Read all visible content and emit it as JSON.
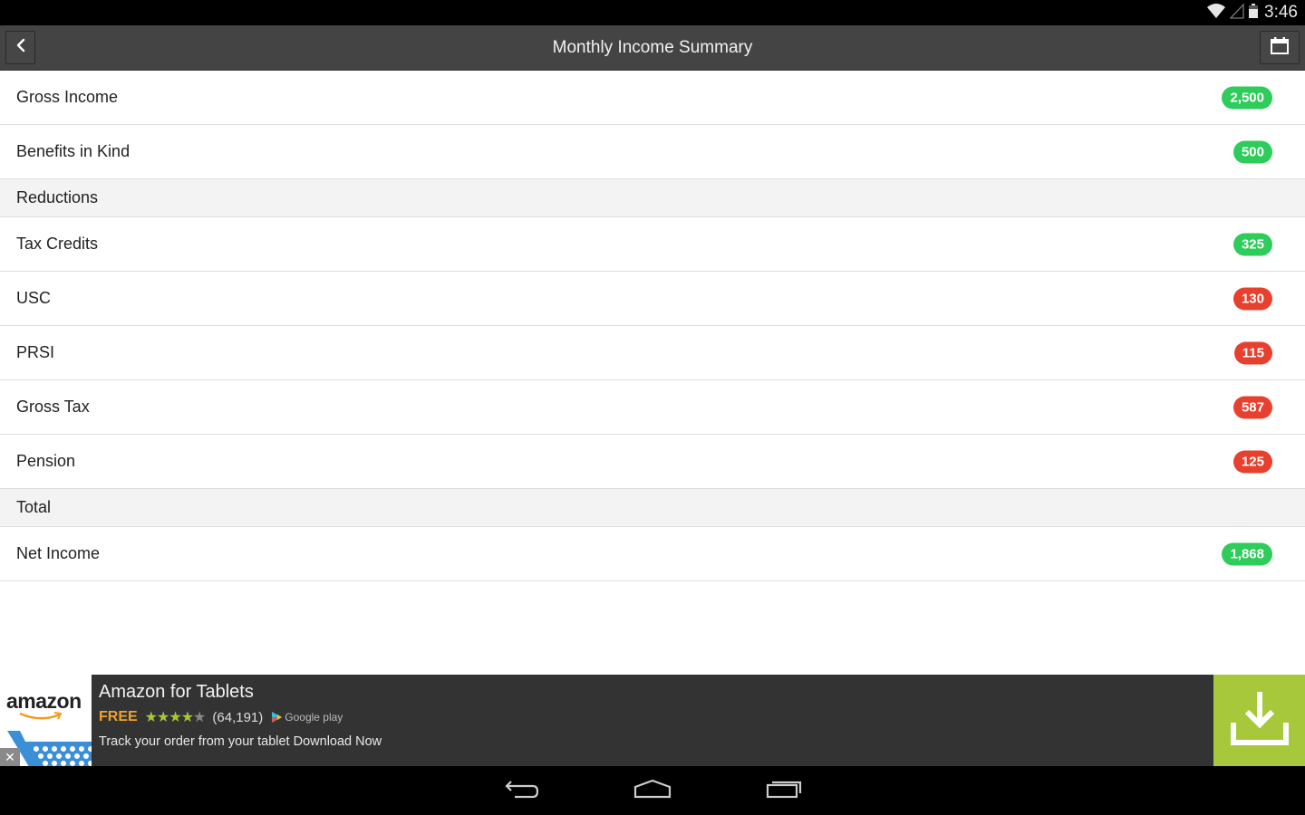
{
  "status_bar": {
    "time": "3:46",
    "icons": [
      "wifi-icon",
      "signal-icon",
      "battery-icon"
    ]
  },
  "action_bar": {
    "title": "Monthly Income Summary",
    "back_icon": "chevron-left-icon",
    "calendar_icon": "calendar-icon"
  },
  "colors": {
    "positive": "#2ecc5a",
    "negative": "#e8402f",
    "action_bar": "#444444",
    "section_bg": "#f3f3f3",
    "ad_accent": "#a6c83a"
  },
  "list": {
    "income": [
      {
        "label": "Gross Income",
        "value": "2,500",
        "status": "positive"
      },
      {
        "label": "Benefits in Kind",
        "value": "500",
        "status": "positive"
      }
    ],
    "reductions_header": "Reductions",
    "reductions": [
      {
        "label": "Tax Credits",
        "value": "325",
        "status": "positive"
      },
      {
        "label": "USC",
        "value": "130",
        "status": "negative"
      },
      {
        "label": "PRSI",
        "value": "115",
        "status": "negative"
      },
      {
        "label": "Gross Tax",
        "value": "587",
        "status": "negative"
      },
      {
        "label": "Pension",
        "value": "125",
        "status": "negative"
      }
    ],
    "total_header": "Total",
    "total": [
      {
        "label": "Net Income",
        "value": "1,868",
        "status": "positive"
      }
    ]
  },
  "ad": {
    "brand": "amazon",
    "title": "Amazon for Tablets",
    "price": "FREE",
    "rating_stars": 4,
    "rating_max": 5,
    "rating_count": "(64,191)",
    "store": "Google play",
    "description": "Track your order from your tablet Download Now",
    "close_label": "✕",
    "download_icon": "download-icon"
  },
  "nav_bar": {
    "buttons": [
      "back-icon",
      "home-icon",
      "recent-apps-icon"
    ]
  }
}
